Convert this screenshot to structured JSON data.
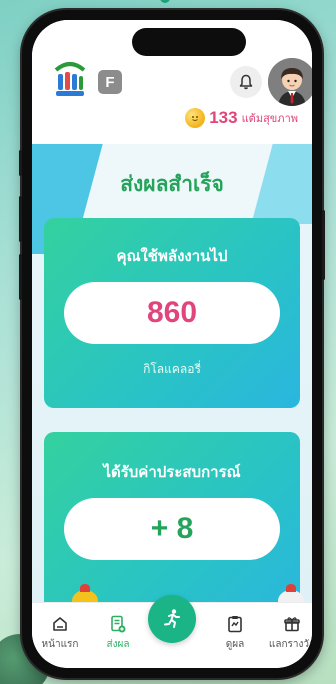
{
  "header": {
    "f_badge": "F",
    "points_value": "133",
    "points_unit": "แต้มสุขภาพ"
  },
  "page": {
    "title": "ส่งผลสำเร็จ"
  },
  "energy_card": {
    "label": "คุณใช้พลังงานไป",
    "value": "860",
    "unit": "กิโลแคลอรี่"
  },
  "experience_card": {
    "label": "ได้รับค่าประสบการณ์",
    "value": "+ 8"
  },
  "tabbar": {
    "items": [
      {
        "label": "หน้าแรก",
        "icon": "home-icon",
        "active": false
      },
      {
        "label": "ส่งผล",
        "icon": "send-result-icon",
        "active": true
      },
      {
        "label": "ดูผล",
        "icon": "clipboard-icon",
        "active": false
      },
      {
        "label": "แลกรางวัล",
        "icon": "gift-icon",
        "active": false
      }
    ],
    "center_icon": "running-icon"
  },
  "colors": {
    "accent_green": "#25a35a",
    "accent_pink": "#e0457b",
    "fab": "#1bb486",
    "card_gradient_start": "#34d19f",
    "card_gradient_end": "#2ab6df"
  }
}
